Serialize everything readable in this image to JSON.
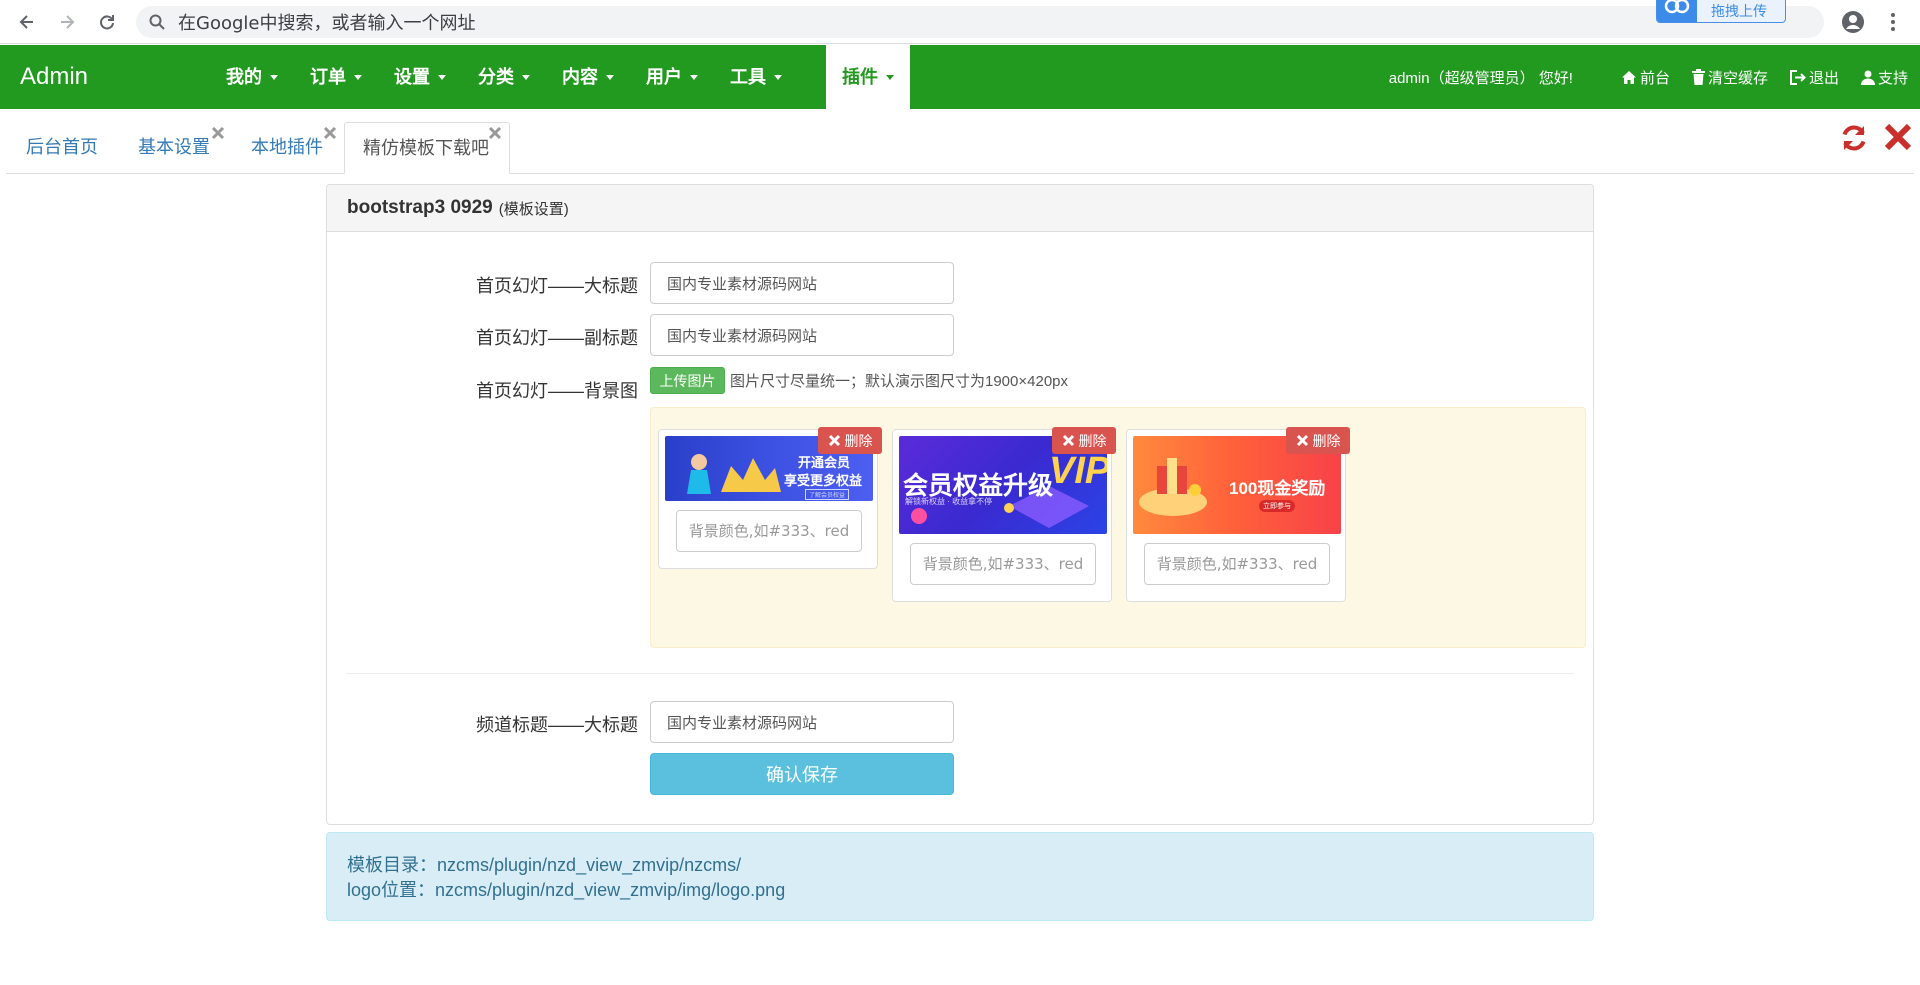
{
  "browser": {
    "omnibox_placeholder": "在Google中搜索，或者输入一个网址",
    "upload_extension_label": "拖拽上传"
  },
  "navbar": {
    "brand": "Admin",
    "menu": [
      {
        "label": "我的"
      },
      {
        "label": "订单"
      },
      {
        "label": "设置"
      },
      {
        "label": "分类"
      },
      {
        "label": "内容"
      },
      {
        "label": "用户"
      },
      {
        "label": "工具"
      },
      {
        "label": "插件",
        "active": true
      }
    ],
    "greeting": "admin（超级管理员） 您好!",
    "links": {
      "home": "前台",
      "clear_cache": "清空缓存",
      "logout": "退出",
      "support": "支持"
    }
  },
  "tabs": [
    {
      "label": "后台首页",
      "closable": false
    },
    {
      "label": "基本设置",
      "closable": true
    },
    {
      "label": "本地插件",
      "closable": true
    },
    {
      "label": "精仿模板下载吧",
      "closable": true,
      "active": true
    }
  ],
  "panel": {
    "title": "bootstrap3 0929",
    "subtitle": "(模板设置)"
  },
  "form": {
    "slide_title_label": "首页幻灯——大标题",
    "slide_title_value": "国内专业素材源码网站",
    "slide_subtitle_label": "首页幻灯——副标题",
    "slide_subtitle_value": "国内专业素材源码网站",
    "slide_bg_label": "首页幻灯——背景图",
    "upload_button": "上传图片",
    "upload_hint": "图片尺寸尽量统一；默认演示图尺寸为1900×420px",
    "images": [
      {
        "banner_line1": "开通会员",
        "banner_line2": "享受更多权益",
        "banner_small": "了解会员权益",
        "delete_label": "删除",
        "color_placeholder": "背景颜色,如#333、red"
      },
      {
        "banner_line1": "会员权益升级",
        "banner_badge": "VIP",
        "banner_small": "解锁新权益 · 收益拿不停",
        "delete_label": "删除",
        "color_placeholder": "背景颜色,如#333、red"
      },
      {
        "banner_line1": "100现金奖励",
        "banner_small": "立即参与",
        "delete_label": "删除",
        "color_placeholder": "背景颜色,如#333、red"
      }
    ],
    "channel_title_label": "频道标题——大标题",
    "channel_title_value": "国内专业素材源码网站",
    "save_button": "确认保存"
  },
  "info": {
    "template_dir": "模板目录：nzcms/plugin/nzd_view_zmvip/nzcms/",
    "logo_path": "logo位置：nzcms/plugin/nzd_view_zmvip/img/logo.png"
  },
  "colors": {
    "navbar_green": "#22991f",
    "upload_green": "#5cb85c",
    "delete_red": "#d9534f",
    "save_blue": "#5bc0de",
    "info_bg": "#d9edf7",
    "gallery_bg": "#fcf8e3"
  }
}
